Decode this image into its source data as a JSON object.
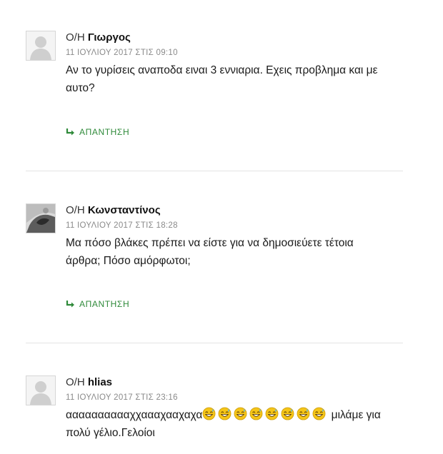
{
  "comments": [
    {
      "prefix": "Ο/Η",
      "author": "Γιωργος",
      "date": "11 ΙΟΥΛΙΟΥ 2017 ΣΤΙΣ 09:10",
      "text": "Αν το γυρίσεις αναποδα ειναι 3 εννιαρια. Εχεις προβλημα και με αυτο?",
      "reply_label": "ΑΠΑΝΤΗΣΗ",
      "avatar": "default-avatar"
    },
    {
      "prefix": "Ο/Η",
      "author": "Κωνσταντίνος",
      "date": "11 ΙΟΥΛΙΟΥ 2017 ΣΤΙΣ 18:28",
      "text": "Μα πόσο βλάκες πρέπει να είστε για να δημοσιεύετε τέτοια άρθρα; Πόσο αμόρφωτοι;",
      "reply_label": "ΑΠΑΝΤΗΣΗ",
      "avatar": "photo-avatar"
    },
    {
      "prefix": "Ο/Η",
      "author": "hlias",
      "date": "11 ΙΟΥΛΙΟΥ 2017 ΣΤΙΣ 23:16",
      "text_before": "ααααααααααχχαααχααχαχα",
      "emoji_count": 8,
      "emoji": "sweat-smile-emoji",
      "text_after": " μιλάμε για πολύ γέλιο.Γελοίοι",
      "avatar": "default-avatar"
    }
  ],
  "colors": {
    "reply": "#2f8a3a",
    "meta": "#8a8a8a",
    "divider": "#e4e4e4"
  }
}
